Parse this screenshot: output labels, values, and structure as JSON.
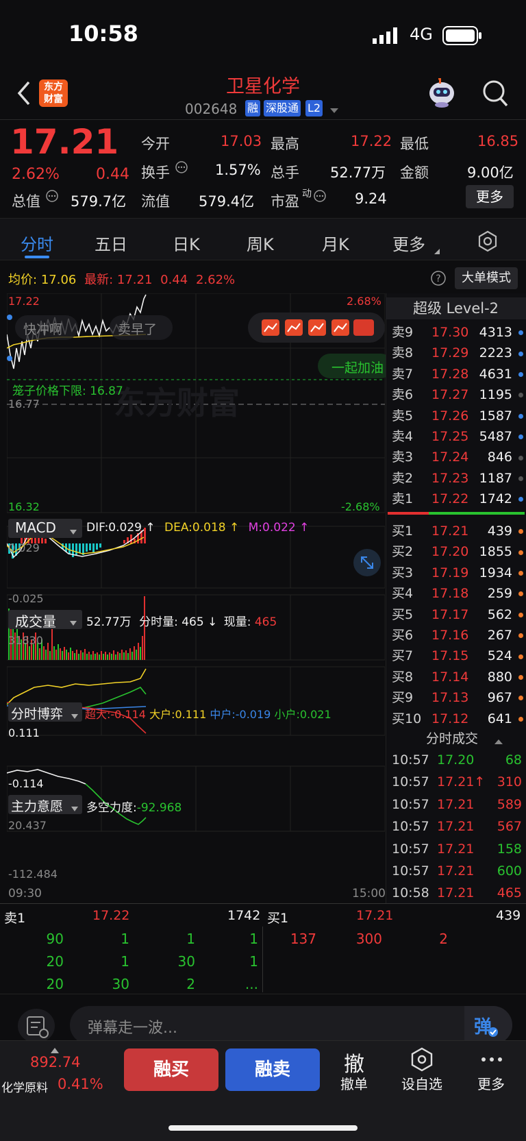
{
  "status": {
    "time": "10:58",
    "network": "4G"
  },
  "header": {
    "logo_line1": "东方",
    "logo_line2": "财富",
    "title": "卫星化学",
    "code": "002648",
    "tags": [
      "融",
      "深股通",
      "L2"
    ]
  },
  "quote": {
    "price": "17.21",
    "pct": "2.62%",
    "change": "0.44",
    "open_label": "今开",
    "open": "17.03",
    "high_label": "最高",
    "high": "17.22",
    "low_label": "最低",
    "low": "16.85",
    "turnover_label": "换手",
    "turnover": "1.57%",
    "volume_label": "总手",
    "volume": "52.77万",
    "amount_label": "金额",
    "amount": "9.00亿",
    "mktcap_label": "总值",
    "mktcap": "579.7亿",
    "float_label": "流值",
    "float": "579.4亿",
    "pe_label": "市盈",
    "pe_sup": "动",
    "pe": "9.24",
    "more": "更多"
  },
  "tabs": [
    "分时",
    "五日",
    "日K",
    "周K",
    "月K",
    "更多"
  ],
  "intraday": {
    "avg_label": "均价:",
    "avg": "17.06",
    "latest_label": "最新:",
    "latest": "17.21",
    "chg": "0.44",
    "pct": "2.62%",
    "bigorder_btn": "大单模式",
    "y_top": "17.22",
    "y_bot": "16.32",
    "pct_top": "2.68%",
    "pct_bot": "-2.68%",
    "mid": "16.77",
    "limit_label": "笼子价格下限: 16.87",
    "danmu": [
      "快冲啊",
      "卖早了",
      "一起加油"
    ],
    "watermark": "东方财富"
  },
  "macd": {
    "label": "MACD",
    "dif": "DIF:0.029 ↑",
    "dea": "DEA:0.018 ↑",
    "m": "M:0.022 ↑",
    "top": "0.029",
    "bot": "-0.025"
  },
  "vol": {
    "label": "成交量",
    "total": "52.77万",
    "minute": "分时量: 465 ↓",
    "now_label": "现量:",
    "now": "465",
    "top": "31830"
  },
  "game": {
    "label": "分时博弈",
    "xl": "超大:-0.114",
    "l": "大户:0.111",
    "m": "中户:-0.019",
    "s": "小户:0.021",
    "top": "0.111",
    "bot": "-0.114"
  },
  "will": {
    "label": "主力意愿",
    "strength_label": "多空力度:",
    "strength": "-92.968",
    "top": "20.437",
    "bot": "-112.484",
    "t_start": "09:30",
    "t_end": "15:00"
  },
  "level2": {
    "title": "超级 Level-2",
    "asks": [
      {
        "l": "卖9",
        "p": "17.30",
        "v": "4313",
        "c": "#3a86e8"
      },
      {
        "l": "卖8",
        "p": "17.29",
        "v": "2223",
        "c": "#3a86e8"
      },
      {
        "l": "卖7",
        "p": "17.28",
        "v": "4631",
        "c": "#3a86e8"
      },
      {
        "l": "卖6",
        "p": "17.27",
        "v": "1195",
        "c": "#555"
      },
      {
        "l": "卖5",
        "p": "17.26",
        "v": "1587",
        "c": "#3a86e8"
      },
      {
        "l": "卖4",
        "p": "17.25",
        "v": "5487",
        "c": "#3a86e8"
      },
      {
        "l": "卖3",
        "p": "17.24",
        "v": "846",
        "c": "#555"
      },
      {
        "l": "卖2",
        "p": "17.23",
        "v": "1187",
        "c": "#555"
      },
      {
        "l": "卖1",
        "p": "17.22",
        "v": "1742",
        "c": "#3a86e8"
      }
    ],
    "bids": [
      {
        "l": "买1",
        "p": "17.21",
        "v": "439",
        "c": "#f07a2a"
      },
      {
        "l": "买2",
        "p": "17.20",
        "v": "1855",
        "c": "#f07a2a"
      },
      {
        "l": "买3",
        "p": "17.19",
        "v": "1934",
        "c": "#f07a2a"
      },
      {
        "l": "买4",
        "p": "17.18",
        "v": "259",
        "c": "#f07a2a"
      },
      {
        "l": "买5",
        "p": "17.17",
        "v": "562",
        "c": "#f07a2a"
      },
      {
        "l": "买6",
        "p": "17.16",
        "v": "267",
        "c": "#f07a2a"
      },
      {
        "l": "买7",
        "p": "17.15",
        "v": "524",
        "c": "#f07a2a"
      },
      {
        "l": "买8",
        "p": "17.14",
        "v": "880",
        "c": "#f07a2a"
      },
      {
        "l": "买9",
        "p": "17.13",
        "v": "967",
        "c": "#f07a2a"
      },
      {
        "l": "买10",
        "p": "17.12",
        "v": "641",
        "c": "#f07a2a"
      }
    ],
    "trades_title": "分时成交",
    "trades": [
      {
        "t": "10:57",
        "p": "17.20",
        "v": "68",
        "pc": "green",
        "vc": "green"
      },
      {
        "t": "10:57",
        "p": "17.21↑",
        "v": "310",
        "pc": "red",
        "vc": "red"
      },
      {
        "t": "10:57",
        "p": "17.21",
        "v": "589",
        "pc": "red",
        "vc": "red"
      },
      {
        "t": "10:57",
        "p": "17.21",
        "v": "567",
        "pc": "red",
        "vc": "red"
      },
      {
        "t": "10:57",
        "p": "17.21",
        "v": "158",
        "pc": "red",
        "vc": "green"
      },
      {
        "t": "10:57",
        "p": "17.21",
        "v": "600",
        "pc": "red",
        "vc": "green"
      },
      {
        "t": "10:58",
        "p": "17.21",
        "v": "465",
        "pc": "red",
        "vc": "red"
      }
    ]
  },
  "queue": {
    "sell_label": "卖1",
    "sell_price": "17.22",
    "sell_vol": "1742",
    "buy_label": "买1",
    "buy_price": "17.21",
    "buy_vol": "439",
    "sell_rows": [
      [
        "90",
        "1",
        "1",
        "1"
      ],
      [
        "20",
        "1",
        "30",
        "1"
      ],
      [
        "20",
        "30",
        "2",
        "..."
      ]
    ],
    "buy_rows": [
      [
        "137",
        "300",
        "2"
      ]
    ]
  },
  "danmu_input": {
    "placeholder": "弹幕走一波...",
    "toggle": "弹"
  },
  "bottom": {
    "index_value": "892.74",
    "index_name": "化学原料",
    "index_pct": "0.41%",
    "buy": "融买",
    "sell": "融卖",
    "cancel_icon": "撤",
    "cancel": "撤单",
    "watch": "设自选",
    "more": "更多"
  }
}
